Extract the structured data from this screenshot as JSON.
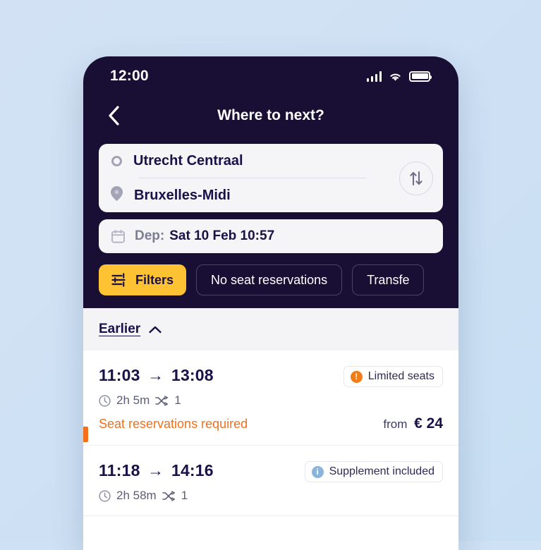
{
  "theme": {
    "background": "#cfe1f4",
    "header_bg": "#190e34",
    "accent_yellow": "#ffc233",
    "accent_orange": "#f4701b",
    "text_dark": "#191147"
  },
  "status_bar": {
    "time": "12:00",
    "signal_icon": "cellular-signal-icon",
    "wifi_icon": "wifi-icon",
    "battery_icon": "battery-icon"
  },
  "header": {
    "back_icon": "chevron-left-icon",
    "title": "Where to next?"
  },
  "search": {
    "origin": {
      "icon": "origin-circle-icon",
      "value": "Utrecht Centraal"
    },
    "destination": {
      "icon": "destination-pin-icon",
      "value": "Bruxelles-Midi"
    },
    "swap_icon": "swap-vertical-icon",
    "date": {
      "icon": "calendar-icon",
      "label": "Dep:",
      "value": "Sat 10 Feb 10:57"
    }
  },
  "filters": {
    "primary": {
      "icon": "sliders-icon",
      "label": "Filters"
    },
    "chips": [
      {
        "label": "No seat reservations"
      },
      {
        "label": "Transfe"
      }
    ]
  },
  "earlier": {
    "label": "Earlier",
    "icon": "chevron-up-icon"
  },
  "journeys": [
    {
      "departure": "11:03",
      "arrow": "→",
      "arrival": "13:08",
      "duration_icon": "clock-icon",
      "duration": "2h 5m",
      "transfers_icon": "transfers-icon",
      "transfers": "1",
      "badge": {
        "icon": "warning-dot-icon",
        "label": "Limited seats",
        "style": "warning"
      },
      "note": "Seat reservations required",
      "has_accent": true,
      "price_prefix": "from",
      "price": "€ 24"
    },
    {
      "departure": "11:18",
      "arrow": "→",
      "arrival": "14:16",
      "duration_icon": "clock-icon",
      "duration": "2h 58m",
      "transfers_icon": "transfers-icon",
      "transfers": "1",
      "badge": {
        "icon": "info-dot-icon",
        "label": "Supplement included",
        "style": "info"
      },
      "note": "",
      "has_accent": false,
      "price_prefix": "",
      "price": ""
    }
  ]
}
